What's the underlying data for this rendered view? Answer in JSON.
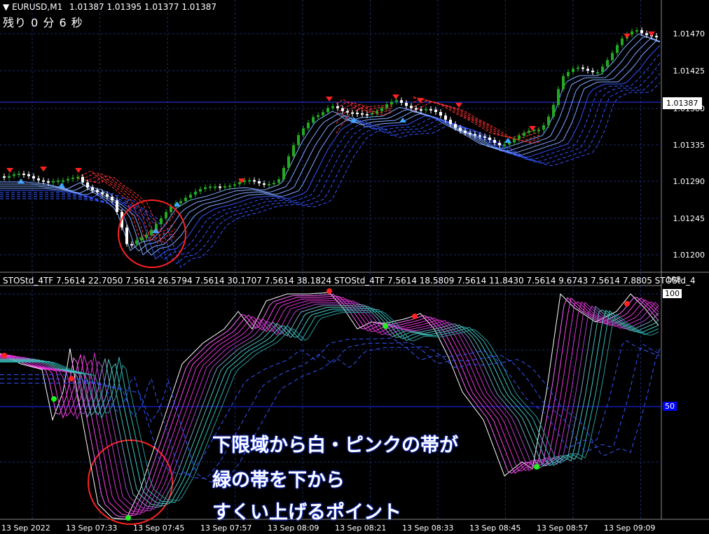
{
  "header": {
    "symbol": "EURUSD,M1",
    "ohlc": "1.01387 1.01395 1.01377 1.01387",
    "timer": "残り 0 分 6 秒"
  },
  "price_axis": {
    "labels": [
      "1.01470",
      "1.01425",
      "1.01387",
      "1.01380",
      "1.01335",
      "1.01290",
      "1.01245",
      "1.01200"
    ],
    "current_price": "1.01387"
  },
  "oscillator": {
    "header": "STOStd_4TF 7.5614 22.7050 7.5614 26.5794 7.5614 30.1707 7.5614 38.1824  STOStd_4TF 7.5614 18.5809 7.5614 11.8430 7.5614 9.6743 7.5614 7.8805  STOStd_4",
    "scale_top": "108",
    "level_100": "100",
    "level_50": "50"
  },
  "time_axis": {
    "labels": [
      "13 Sep 2022",
      "13 Sep 07:33",
      "13 Sep 07:45",
      "13 Sep 07:57",
      "13 Sep 08:09",
      "13 Sep 08:21",
      "13 Sep 08:33",
      "13 Sep 08:45",
      "13 Sep 08:57",
      "13 Sep 09:09"
    ]
  },
  "annotation": {
    "line1": "下限域から白・ピンクの帯が",
    "line2": "緑の帯を下から",
    "line3": "すくい上げるポイント"
  },
  "colors": {
    "background": "#000000",
    "grid": "#1a2a6a",
    "bull_candle": "#22aa22",
    "bear_candle": "#ffffff",
    "fast_band": "#ff33ff",
    "slow_band": "#33cccc",
    "ma_blue": "#3355ff",
    "ma_red": "#ff3333",
    "highlight_circle": "#ff2222"
  }
}
